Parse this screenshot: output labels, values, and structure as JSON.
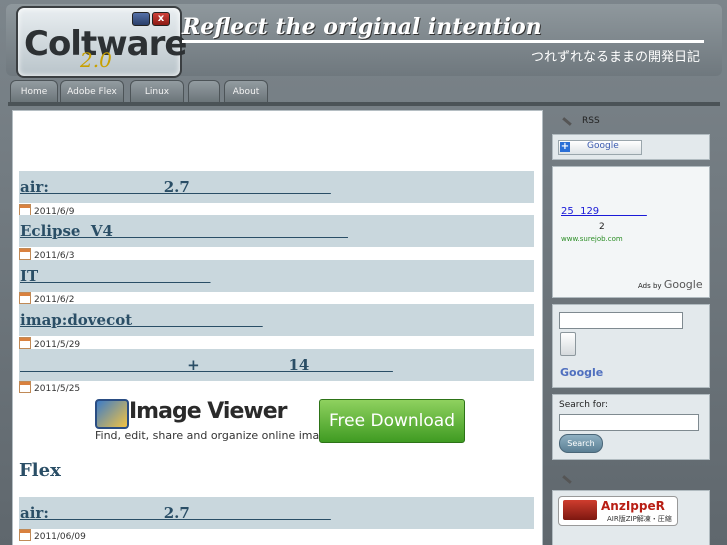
{
  "header": {
    "logo_main": "Coltware",
    "logo_version": "2.0",
    "close_glyph": "x",
    "title": "Reflect the original intention",
    "subtitle": "つれずれなるままの開発日記"
  },
  "nav": {
    "tabs": [
      "Home",
      "Adobe Flex",
      "Linux",
      "",
      "About"
    ]
  },
  "posts": [
    {
      "title": "air:                      2.7                           ",
      "date": "2011/6/9"
    },
    {
      "title": "Eclipse  V4                                             ",
      "date": "2011/6/3"
    },
    {
      "title": "IT                                 ",
      "date": "2011/6/2"
    },
    {
      "title": "imap:dovecot                         ",
      "date": "2011/5/29"
    },
    {
      "title": "                                +                 14                ",
      "date": "2011/5/25"
    }
  ],
  "banner": {
    "title": "Image Viewer",
    "tagline": "Find, edit, share and organize online images.",
    "button": "Free Download"
  },
  "section_heading": "Flex",
  "flex_posts": [
    {
      "title": "air:                      2.7                           ",
      "date": "2011/06/09"
    }
  ],
  "sidebar": {
    "rss_heading": "RSS",
    "google_add": "Google",
    "ad_link": "25  129               ",
    "ad_num": "2",
    "ad_url": "www.surejob.com",
    "ads_by_prefix": "Ads by",
    "ads_by_brand": "Google",
    "google_logo": "Google",
    "search_label": "Search for:",
    "search_button": "Search",
    "anz_name": "AnzIppeR",
    "anz_sub": "AIR版ZIP解凍・圧縮"
  },
  "colors": {
    "accent": "#2a4e66",
    "post_bar": "#c9d7dd",
    "download_green": "#3f9b22"
  }
}
